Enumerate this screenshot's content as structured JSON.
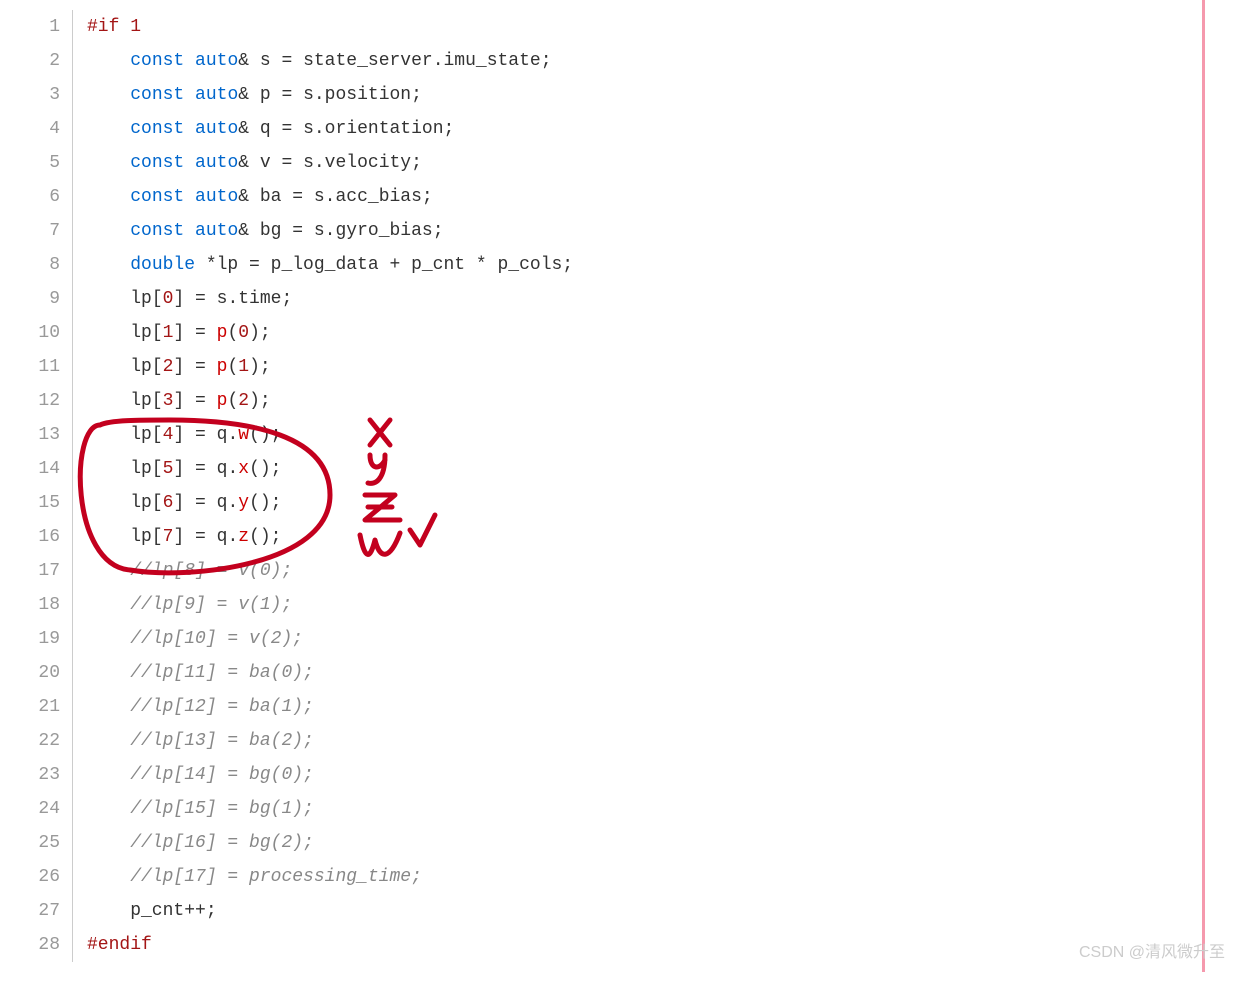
{
  "watermark": "CSDN @清风微升至",
  "lines": [
    {
      "n": 1,
      "tokens": [
        {
          "t": "#if",
          "c": "tok-directive"
        },
        {
          "t": " "
        },
        {
          "t": "1",
          "c": "tok-number"
        }
      ]
    },
    {
      "n": 2,
      "tokens": [
        {
          "t": "    "
        },
        {
          "t": "const",
          "c": "tok-keyword"
        },
        {
          "t": " "
        },
        {
          "t": "auto",
          "c": "tok-keyword"
        },
        {
          "t": "& s = state_server.imu_state;",
          "c": "tok-ident"
        }
      ]
    },
    {
      "n": 3,
      "tokens": [
        {
          "t": "    "
        },
        {
          "t": "const",
          "c": "tok-keyword"
        },
        {
          "t": " "
        },
        {
          "t": "auto",
          "c": "tok-keyword"
        },
        {
          "t": "& p = s.position;",
          "c": "tok-ident"
        }
      ]
    },
    {
      "n": 4,
      "tokens": [
        {
          "t": "    "
        },
        {
          "t": "const",
          "c": "tok-keyword"
        },
        {
          "t": " "
        },
        {
          "t": "auto",
          "c": "tok-keyword"
        },
        {
          "t": "& q = s.orientation;",
          "c": "tok-ident"
        }
      ]
    },
    {
      "n": 5,
      "tokens": [
        {
          "t": "    "
        },
        {
          "t": "const",
          "c": "tok-keyword"
        },
        {
          "t": " "
        },
        {
          "t": "auto",
          "c": "tok-keyword"
        },
        {
          "t": "& v = s.velocity;",
          "c": "tok-ident"
        }
      ]
    },
    {
      "n": 6,
      "tokens": [
        {
          "t": "    "
        },
        {
          "t": "const",
          "c": "tok-keyword"
        },
        {
          "t": " "
        },
        {
          "t": "auto",
          "c": "tok-keyword"
        },
        {
          "t": "& ba = s.acc_bias;",
          "c": "tok-ident"
        }
      ]
    },
    {
      "n": 7,
      "tokens": [
        {
          "t": "    "
        },
        {
          "t": "const",
          "c": "tok-keyword"
        },
        {
          "t": " "
        },
        {
          "t": "auto",
          "c": "tok-keyword"
        },
        {
          "t": "& bg = s.gyro_bias;",
          "c": "tok-ident"
        }
      ]
    },
    {
      "n": 8,
      "tokens": [
        {
          "t": "    "
        },
        {
          "t": "double",
          "c": "tok-keyword"
        },
        {
          "t": " *lp = p_log_data + p_cnt * p_cols;",
          "c": "tok-ident"
        }
      ]
    },
    {
      "n": 9,
      "tokens": [
        {
          "t": "    lp["
        },
        {
          "t": "0",
          "c": "tok-number"
        },
        {
          "t": "] = s.time;"
        }
      ]
    },
    {
      "n": 10,
      "tokens": [
        {
          "t": "    lp["
        },
        {
          "t": "1",
          "c": "tok-number"
        },
        {
          "t": "] = "
        },
        {
          "t": "p",
          "c": "tok-call"
        },
        {
          "t": "("
        },
        {
          "t": "0",
          "c": "tok-number"
        },
        {
          "t": ");"
        }
      ]
    },
    {
      "n": 11,
      "tokens": [
        {
          "t": "    lp["
        },
        {
          "t": "2",
          "c": "tok-number"
        },
        {
          "t": "] = "
        },
        {
          "t": "p",
          "c": "tok-call"
        },
        {
          "t": "("
        },
        {
          "t": "1",
          "c": "tok-number"
        },
        {
          "t": ");"
        }
      ]
    },
    {
      "n": 12,
      "tokens": [
        {
          "t": "    lp["
        },
        {
          "t": "3",
          "c": "tok-number"
        },
        {
          "t": "] = "
        },
        {
          "t": "p",
          "c": "tok-call"
        },
        {
          "t": "("
        },
        {
          "t": "2",
          "c": "tok-number"
        },
        {
          "t": ");"
        }
      ]
    },
    {
      "n": 13,
      "tokens": [
        {
          "t": "    lp["
        },
        {
          "t": "4",
          "c": "tok-number"
        },
        {
          "t": "] = q."
        },
        {
          "t": "w",
          "c": "tok-call"
        },
        {
          "t": "();"
        }
      ]
    },
    {
      "n": 14,
      "tokens": [
        {
          "t": "    lp["
        },
        {
          "t": "5",
          "c": "tok-number"
        },
        {
          "t": "] = q."
        },
        {
          "t": "x",
          "c": "tok-call"
        },
        {
          "t": "();"
        }
      ]
    },
    {
      "n": 15,
      "tokens": [
        {
          "t": "    lp["
        },
        {
          "t": "6",
          "c": "tok-number"
        },
        {
          "t": "] = q."
        },
        {
          "t": "y",
          "c": "tok-call"
        },
        {
          "t": "();"
        }
      ]
    },
    {
      "n": 16,
      "tokens": [
        {
          "t": "    lp["
        },
        {
          "t": "7",
          "c": "tok-number"
        },
        {
          "t": "] = q."
        },
        {
          "t": "z",
          "c": "tok-call"
        },
        {
          "t": "();"
        }
      ]
    },
    {
      "n": 17,
      "tokens": [
        {
          "t": "    "
        },
        {
          "t": "//lp[8] = v(0);",
          "c": "tok-comment"
        }
      ]
    },
    {
      "n": 18,
      "tokens": [
        {
          "t": "    "
        },
        {
          "t": "//lp[9] = v(1);",
          "c": "tok-comment"
        }
      ]
    },
    {
      "n": 19,
      "tokens": [
        {
          "t": "    "
        },
        {
          "t": "//lp[10] = v(2);",
          "c": "tok-comment"
        }
      ]
    },
    {
      "n": 20,
      "tokens": [
        {
          "t": "    "
        },
        {
          "t": "//lp[11] = ba(0);",
          "c": "tok-comment"
        }
      ]
    },
    {
      "n": 21,
      "tokens": [
        {
          "t": "    "
        },
        {
          "t": "//lp[12] = ba(1);",
          "c": "tok-comment"
        }
      ]
    },
    {
      "n": 22,
      "tokens": [
        {
          "t": "    "
        },
        {
          "t": "//lp[13] = ba(2);",
          "c": "tok-comment"
        }
      ]
    },
    {
      "n": 23,
      "tokens": [
        {
          "t": "    "
        },
        {
          "t": "//lp[14] = bg(0);",
          "c": "tok-comment"
        }
      ]
    },
    {
      "n": 24,
      "tokens": [
        {
          "t": "    "
        },
        {
          "t": "//lp[15] = bg(1);",
          "c": "tok-comment"
        }
      ]
    },
    {
      "n": 25,
      "tokens": [
        {
          "t": "    "
        },
        {
          "t": "//lp[16] = bg(2);",
          "c": "tok-comment"
        }
      ]
    },
    {
      "n": 26,
      "tokens": [
        {
          "t": "    "
        },
        {
          "t": "//lp[17] = processing_time;",
          "c": "tok-comment"
        }
      ]
    },
    {
      "n": 27,
      "tokens": [
        {
          "t": "    p_cnt++;"
        }
      ]
    },
    {
      "n": 28,
      "tokens": [
        {
          "t": "#endif",
          "c": "tok-directive"
        }
      ]
    }
  ],
  "annotation_letters": [
    "x",
    "y",
    "z",
    "w"
  ]
}
